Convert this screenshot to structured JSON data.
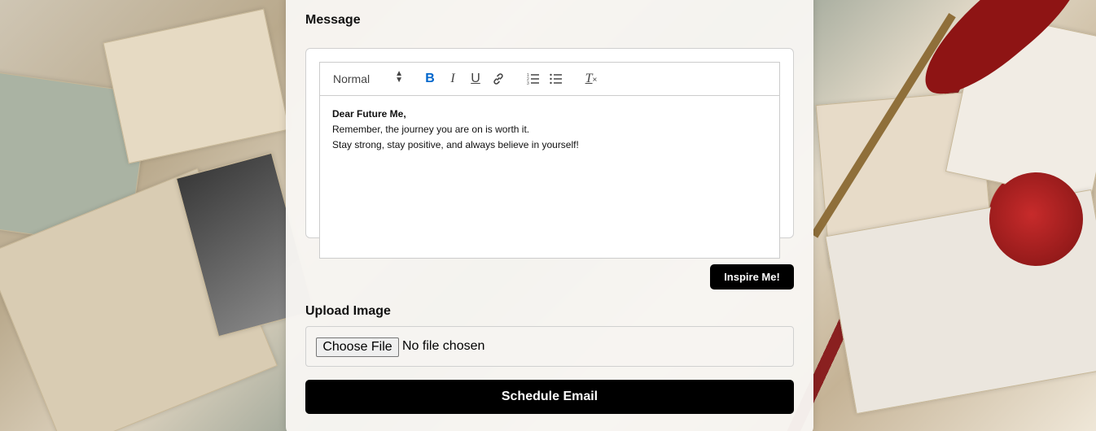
{
  "form": {
    "message_label": "Message",
    "upload_label": "Upload Image"
  },
  "editor": {
    "format_select": "Normal",
    "toolbar": {
      "bold": "B",
      "italic": "I",
      "underline": "U",
      "clean": "T"
    },
    "content": {
      "line1": "Dear Future Me,",
      "line2": "Remember, the journey you are on is worth it.",
      "line3": "Stay strong, stay positive, and always believe in yourself!"
    }
  },
  "buttons": {
    "inspire": "Inspire Me!",
    "choose_file": "Choose File",
    "schedule": "Schedule Email"
  },
  "upload": {
    "status": "No file chosen"
  },
  "colors": {
    "primary_button": "#000000",
    "bold_active": "#0066cc"
  },
  "icons": {
    "link": "link-icon",
    "ordered_list": "ordered-list-icon",
    "bullet_list": "bullet-list-icon",
    "clean_format": "clear-format-icon",
    "select_arrows": "select-arrows-icon"
  }
}
